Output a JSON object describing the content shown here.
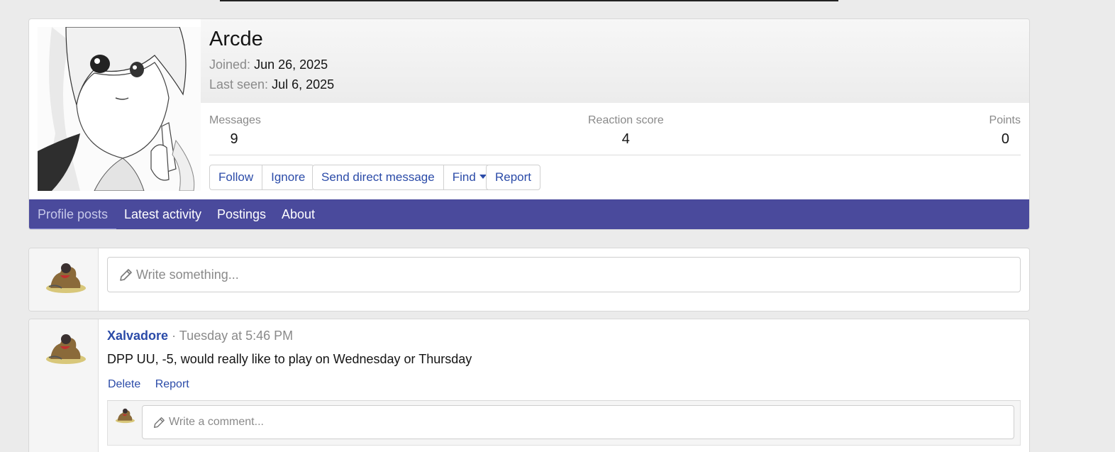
{
  "profile": {
    "username": "Arcde",
    "joined_label": "Joined:",
    "joined_value": "Jun 26, 2025",
    "last_seen_label": "Last seen:",
    "last_seen_value": "Jul 6, 2025",
    "stats": {
      "messages_label": "Messages",
      "messages_value": "9",
      "reaction_label": "Reaction score",
      "reaction_value": "4",
      "points_label": "Points",
      "points_value": "0"
    },
    "buttons": {
      "follow": "Follow",
      "ignore": "Ignore",
      "send_dm": "Send direct message",
      "find": "Find",
      "report": "Report"
    },
    "tabs": [
      "Profile posts",
      "Latest activity",
      "Postings",
      "About"
    ],
    "active_tab": "Profile posts"
  },
  "composer": {
    "placeholder": "Write something..."
  },
  "post": {
    "author": "Xalvadore",
    "separator": "·",
    "time": "Tuesday at 5:46 PM",
    "body": "DPP UU, -5, would really like to play on Wednesday or Thursday",
    "actions": {
      "delete": "Delete",
      "report": "Report"
    },
    "comment_placeholder": "Write a comment..."
  },
  "colors": {
    "accent_nav": "#4a4a9c",
    "link": "#2b4ba8",
    "muted": "#8a8a8a",
    "background": "#ebebeb"
  },
  "icons": [
    "pencil-icon",
    "caret-down-icon"
  ]
}
